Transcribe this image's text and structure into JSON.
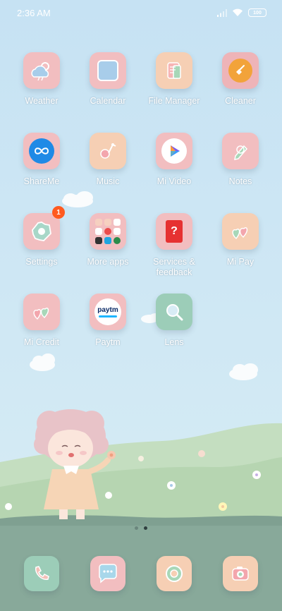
{
  "status_bar": {
    "time": "2:36 AM",
    "battery": "100"
  },
  "apps": [
    {
      "label": "Weather",
      "icon": "weather-cloud-icon"
    },
    {
      "label": "Calendar",
      "icon": "calendar-icon"
    },
    {
      "label": "File Manager",
      "icon": "folder-icon"
    },
    {
      "label": "Cleaner",
      "icon": "broom-icon"
    },
    {
      "label": "ShareMe",
      "icon": "shareme-infinity-icon"
    },
    {
      "label": "Music",
      "icon": "music-note-icon"
    },
    {
      "label": "Mi Video",
      "icon": "play-icon"
    },
    {
      "label": "Notes",
      "icon": "pencil-icon"
    },
    {
      "label": "Settings",
      "icon": "gear-icon",
      "badge": "1"
    },
    {
      "label": "More apps",
      "icon": "app-folder-icon"
    },
    {
      "label": "Services &\nfeedback",
      "icon": "help-bag-icon"
    },
    {
      "label": "Mi Pay",
      "icon": "hearts-icon"
    },
    {
      "label": "Mi Credit",
      "icon": "hearts-icon"
    },
    {
      "label": "Paytm",
      "icon": "paytm-logo-icon",
      "logo_text": "paytm"
    },
    {
      "label": "Lens",
      "icon": "magnifier-icon"
    }
  ],
  "dock": [
    {
      "name": "phone",
      "icon": "phone-icon"
    },
    {
      "name": "messages",
      "icon": "chat-bubble-icon"
    },
    {
      "name": "browser",
      "icon": "browser-globe-icon"
    },
    {
      "name": "camera",
      "icon": "camera-icon"
    }
  ],
  "pages": {
    "count": 2,
    "active": 2
  },
  "colors": {
    "sky": "#cfe7f4",
    "grass": "#b8d6b3",
    "ground": "#7fa596",
    "tile_pink": "#f2bec0",
    "tile_peach": "#f6cfb4",
    "tile_green": "#9ccdb8",
    "badge": "#ff5a1f"
  }
}
